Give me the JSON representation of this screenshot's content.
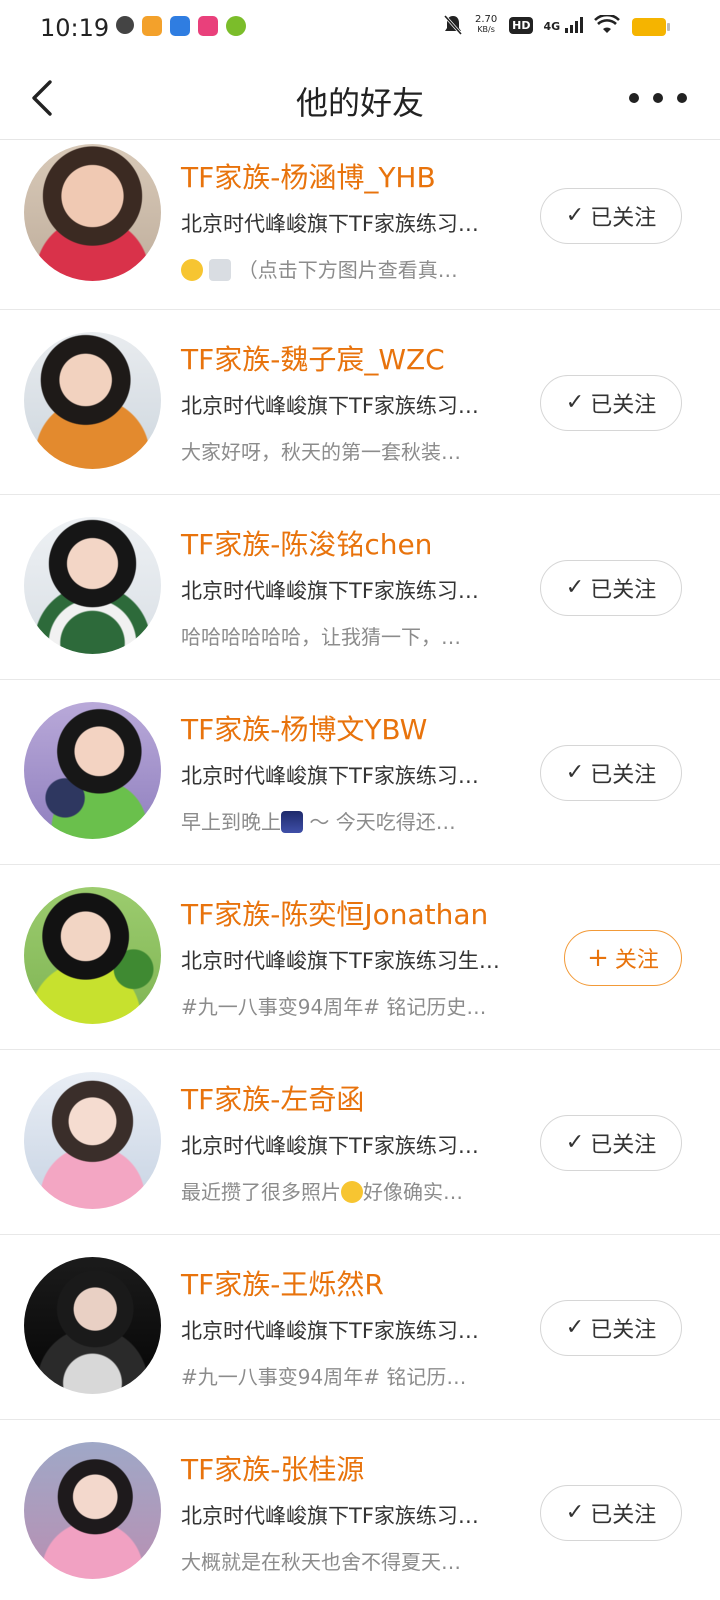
{
  "status_bar": {
    "time": "10:19",
    "net_speed_value": "2.70",
    "net_speed_unit": "KB/s",
    "hd": "HD",
    "signal": "4G",
    "battery_color": "#f5b400"
  },
  "header": {
    "title": "他的好友"
  },
  "colors": {
    "accent": "#e8730c"
  },
  "friends": [
    {
      "name": "TF家族-杨涵博_YHB",
      "description": "北京时代峰峻旗下TF家族练习…",
      "status": "（点击下方图片查看真…",
      "follow_label": "已关注",
      "follow_icon": "checkmark-icon"
    },
    {
      "name": "TF家族-魏子宸_WZC",
      "description": "北京时代峰峻旗下TF家族练习…",
      "status": "大家好呀，秋天的第一套秋装…",
      "follow_label": "已关注",
      "follow_icon": "checkmark-icon"
    },
    {
      "name": "TF家族-陈浚铭chen",
      "description": "北京时代峰峻旗下TF家族练习…",
      "status": "哈哈哈哈哈哈，让我猜一下，…",
      "follow_label": "已关注",
      "follow_icon": "checkmark-icon"
    },
    {
      "name": "TF家族-杨博文YBW",
      "description": "北京时代峰峻旗下TF家族练习…",
      "status": "早上到晚上",
      "status_tail": "～ 今天吃得还…",
      "follow_label": "已关注",
      "follow_icon": "checkmark-icon"
    },
    {
      "name": "TF家族-陈奕恒Jonathan",
      "description": "北京时代峰峻旗下TF家族练习生…",
      "status": "#九一八事变94周年# 铭记历史…",
      "follow_label": "关注",
      "follow_icon": "plus-icon"
    },
    {
      "name": "TF家族-左奇函",
      "description": "北京时代峰峻旗下TF家族练习…",
      "status": "最近攒了很多照片",
      "status_tail": "好像确实…",
      "follow_label": "已关注",
      "follow_icon": "checkmark-icon"
    },
    {
      "name": "TF家族-王烁然R",
      "description": "北京时代峰峻旗下TF家族练习…",
      "status": "#九一八事变94周年# 铭记历…",
      "follow_label": "已关注",
      "follow_icon": "checkmark-icon"
    },
    {
      "name": "TF家族-张桂源",
      "description": "北京时代峰峻旗下TF家族练习…",
      "status": "大概就是在秋天也舍不得夏天…",
      "follow_label": "已关注",
      "follow_icon": "checkmark-icon"
    }
  ]
}
